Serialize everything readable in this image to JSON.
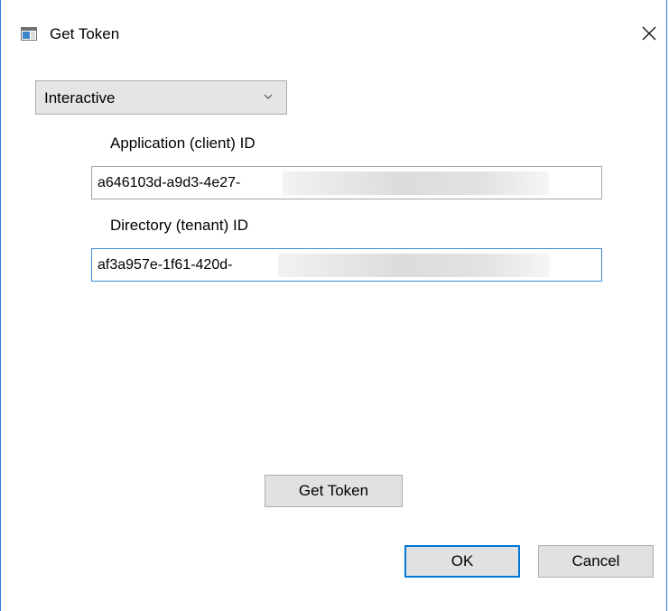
{
  "window": {
    "title": "Get Token",
    "app_icon": "window-app-icon",
    "close_icon": "close-icon"
  },
  "auth_mode": {
    "selected": "Interactive",
    "chevron_icon": "chevron-down-icon"
  },
  "fields": {
    "client_id": {
      "label": "Application (client) ID",
      "value": "a646103d-a9d3-4e27-"
    },
    "tenant_id": {
      "label": "Directory (tenant) ID",
      "value": "af3a957e-1f61-420d-"
    }
  },
  "buttons": {
    "get_token": "Get Token",
    "ok": "OK",
    "cancel": "Cancel"
  },
  "colors": {
    "window_border": "#2b79d7",
    "focus_border": "#3c8dd8",
    "button_face": "#e1e1e1",
    "default_button_border": "#0078d7"
  }
}
